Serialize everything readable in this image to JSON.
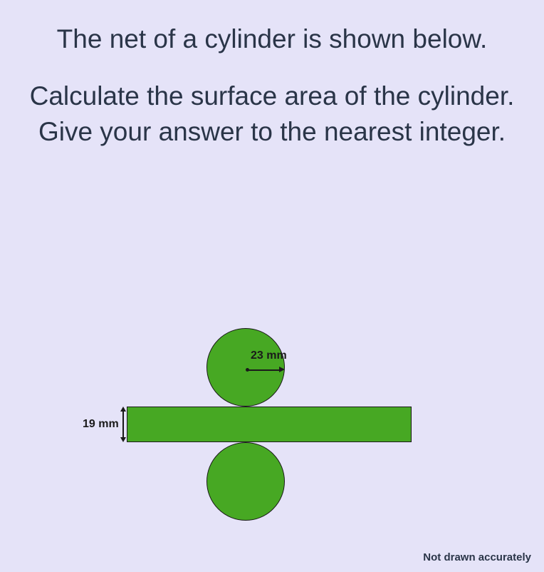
{
  "question": {
    "line1": "The net of a cylinder is shown below.",
    "line2": "Calculate the surface area of the cylinder.",
    "line3": "Give your answer to the nearest integer."
  },
  "diagram": {
    "radius_label": "23 mm",
    "height_label": "19 mm",
    "disclaimer": "Not drawn accurately"
  },
  "chart_data": {
    "type": "diagram",
    "description": "Net of a cylinder: two circles (top and bottom bases) and a rectangle (lateral surface)",
    "radius_mm": 23,
    "height_mm": 19,
    "shapes": [
      {
        "shape": "circle",
        "radius_mm": 23,
        "position": "top"
      },
      {
        "shape": "rectangle",
        "height_mm": 19,
        "width": "circumference"
      },
      {
        "shape": "circle",
        "radius_mm": 23,
        "position": "bottom"
      }
    ]
  }
}
